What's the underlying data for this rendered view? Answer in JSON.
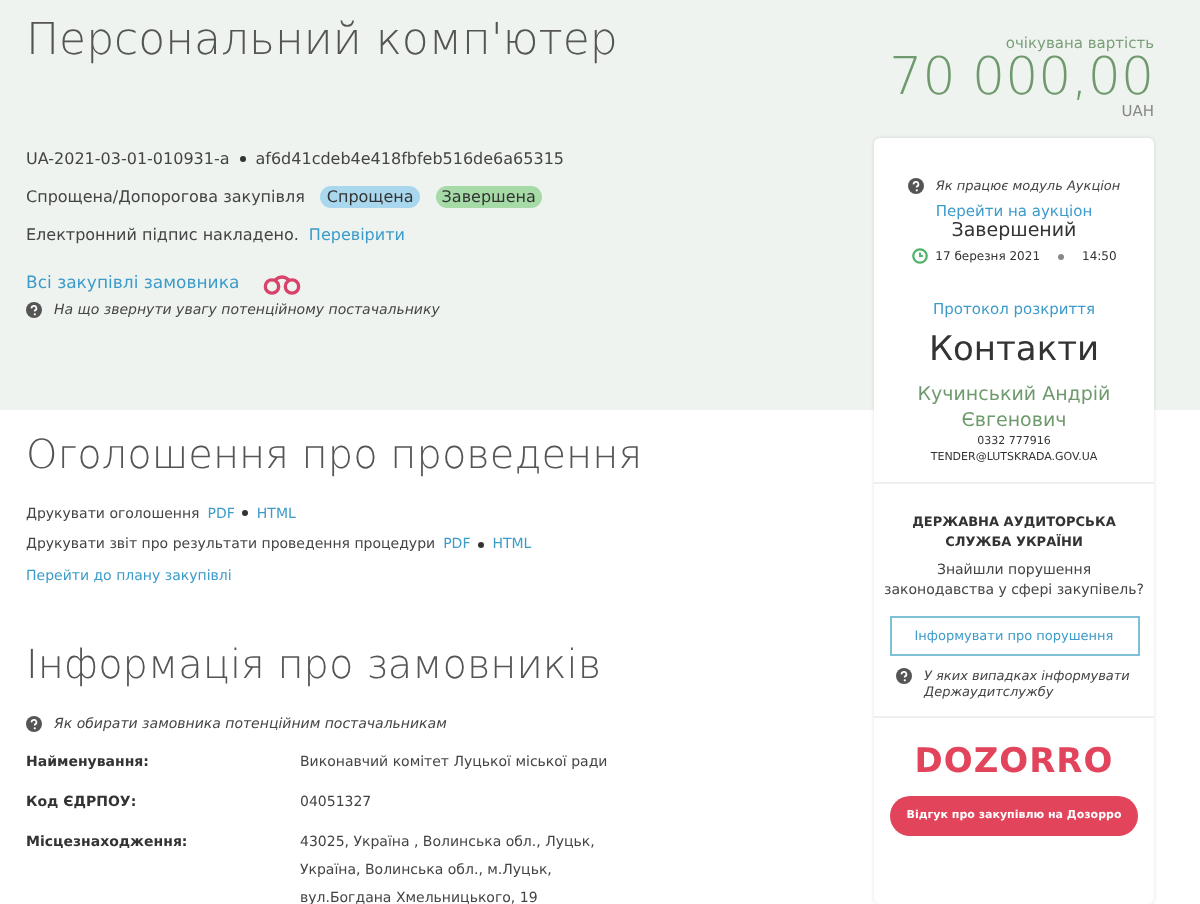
{
  "title": "Персональний комп'ютер",
  "tender_id": "UA-2021-03-01-010931-a",
  "hash": "af6d41cdeb4e418fbfeb516de6a65315",
  "procedure_type": "Спрощена/Допорогова закупівля",
  "badges": [
    {
      "label": "Спрощена",
      "color": "#a9d8ee"
    },
    {
      "label": "Завершена",
      "color": "#a6dba8"
    }
  ],
  "signature": {
    "text": "Електронний підпис накладено.",
    "link": "Перевірити"
  },
  "buyer_link": "Всі закупівлі замовника",
  "hint": "На що звернути увагу потенційному постачальнику",
  "price": {
    "label": "очікувана вартість",
    "amount": "70 000,00",
    "currency": "UAH"
  },
  "auction": {
    "hint": "Як працює модуль Аукціон",
    "link": "Перейти на аукціон",
    "status": "Завершений",
    "date": "17 березня 2021",
    "time": "14:50",
    "protocol": "Протокол розкриття"
  },
  "contacts": {
    "heading": "Контакти",
    "name": "Кучинський Андрій Євгенович",
    "phone": "0332 777916",
    "email": "TENDER@LUTSKRADA.GOV.UA"
  },
  "audit": {
    "heading": "ДЕРЖАВНА АУДИТОРСЬКА СЛУЖБА УКРАЇНИ",
    "question": "Знайшли порушення законодавства у сфері закупівель?",
    "button": "Інформувати про порушення",
    "hint": "У яких випадках інформувати Держаудитслужбу"
  },
  "dozorro": {
    "logo": "DOZORRO",
    "button": "Відгук про закупівлю на Дозорро"
  },
  "announcement": {
    "heading": "Оголошення про проведення",
    "prints": [
      {
        "text": "Друкувати оголошення",
        "links": [
          "PDF",
          "HTML"
        ]
      },
      {
        "text": "Друкувати звіт про результати проведення процедури",
        "links": [
          "PDF",
          "HTML"
        ]
      }
    ],
    "plan_link": "Перейти до плану закупівлі"
  },
  "buyers": {
    "heading": "Інформація про замовників",
    "hint": "Як обирати замовника потенційним постачальникам",
    "rows": [
      {
        "label": "Найменування:",
        "value": "Виконавчий комітет Луцької міської ради"
      },
      {
        "label": "Код ЄДРПОУ:",
        "value": "04051327"
      },
      {
        "label": "Місцезнаходження:",
        "value": "43025, Україна , Волинська обл., Луцьк, Україна, Волинська обл., м.Луцьк, вул.Богдана Хмельницького, 19"
      }
    ]
  }
}
